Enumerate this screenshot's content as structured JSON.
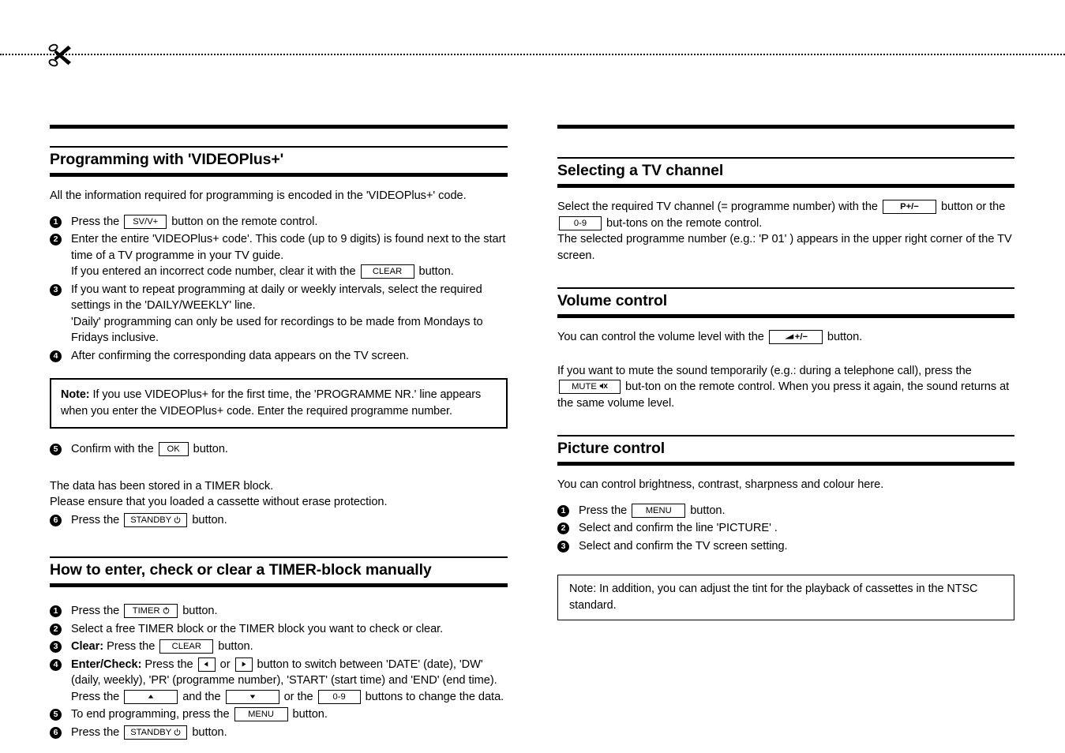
{
  "page": {
    "cut_line_icon": "scissors-icon"
  },
  "left_column": {
    "section1": {
      "title": "Programming with 'VIDEOPlus+'",
      "intro": "All the information required for programming is encoded in the 'VIDEOPlus+' code.",
      "steps": [
        {
          "num": "1",
          "lines": [
            {
              "parts": [
                {
                  "t": "text",
                  "v": "Press the "
                },
                {
                  "t": "key",
                  "v": "SV/V+"
                },
                {
                  "t": "text",
                  "v": " button on the remote control."
                }
              ]
            }
          ]
        },
        {
          "num": "2",
          "lines": [
            {
              "parts": [
                {
                  "t": "text",
                  "v": "Enter the entire 'VIDEOPlus+ code'. This code (up to 9 digits) is found next to the start time of a TV programme in your TV guide."
                }
              ]
            },
            {
              "parts": [
                {
                  "t": "text",
                  "v": "If you entered an incorrect code number, clear it with the "
                },
                {
                  "t": "key",
                  "v": "CLEAR"
                },
                {
                  "t": "text",
                  "v": " button."
                }
              ]
            }
          ]
        },
        {
          "num": "3",
          "lines": [
            {
              "parts": [
                {
                  "t": "text",
                  "v": "If you want to repeat programming at daily or weekly intervals, select the required settings in the 'DAILY/WEEKLY' line."
                }
              ]
            },
            {
              "parts": [
                {
                  "t": "text",
                  "v": "'Daily' programming can only be used for recordings to be made from Mondays to Fridays inclusive."
                }
              ]
            }
          ]
        },
        {
          "num": "4",
          "lines": [
            {
              "parts": [
                {
                  "t": "text",
                  "v": "After confirming the corresponding data appears on the TV screen."
                }
              ]
            }
          ]
        }
      ],
      "note": {
        "label": "Note:",
        "text": " If you use VIDEOPlus+ for the first time, the 'PROGRAMME NR.' line appears when you enter the VIDEOPlus+ code. Enter the required programme number."
      },
      "step5": {
        "num": "5",
        "parts": [
          {
            "t": "text",
            "v": "Confirm with the "
          },
          {
            "t": "key",
            "v": "OK"
          },
          {
            "t": "text",
            "v": " button."
          }
        ]
      },
      "closing": [
        "The data has been stored in a TIMER block.",
        "Please ensure that you loaded a cassette without erase protection."
      ],
      "step6": {
        "num": "6",
        "parts": [
          {
            "t": "text",
            "v": "Press the "
          },
          {
            "t": "key",
            "v": "STANDBY",
            "icon": "power-icon"
          },
          {
            "t": "text",
            "v": " button."
          }
        ]
      }
    },
    "section2": {
      "title": "How to enter, check or clear a TIMER-block manually",
      "steps": [
        {
          "num": "1",
          "parts": [
            {
              "t": "text",
              "v": "Press the "
            },
            {
              "t": "key",
              "v": "TIMER",
              "icon": "timer-icon"
            },
            {
              "t": "text",
              "v": " button."
            }
          ]
        },
        {
          "num": "2",
          "parts": [
            {
              "t": "text",
              "v": "Select a free TIMER block or the TIMER block you want to check or clear."
            }
          ]
        },
        {
          "num": "3",
          "parts": [
            {
              "t": "bold",
              "v": "Clear:"
            },
            {
              "t": "text",
              "v": " Press the "
            },
            {
              "t": "key",
              "v": "CLEAR"
            },
            {
              "t": "text",
              "v": " button."
            }
          ]
        },
        {
          "num": "4",
          "parts": [
            {
              "t": "bold",
              "v": "Enter/Check:"
            },
            {
              "t": "text",
              "v": " Press the "
            },
            {
              "t": "key_icon",
              "v": "left-triangle-icon"
            },
            {
              "t": "text",
              "v": " or "
            },
            {
              "t": "key_icon",
              "v": "right-triangle-icon"
            },
            {
              "t": "text",
              "v": " button to switch between 'DATE' (date), 'DW' (daily, weekly), 'PR' (programme number), 'START' (start time) and 'END' (end time)."
            }
          ],
          "line2": [
            {
              "t": "text",
              "v": "Press the "
            },
            {
              "t": "key_icon",
              "v": "up-triangle-icon"
            },
            {
              "t": "text",
              "v": " and the "
            },
            {
              "t": "key_icon",
              "v": "down-triangle-icon"
            },
            {
              "t": "text",
              "v": " or the "
            },
            {
              "t": "key",
              "v": "0-9"
            },
            {
              "t": "text",
              "v": " buttons to change the data."
            }
          ]
        },
        {
          "num": "5",
          "parts": [
            {
              "t": "text",
              "v": "To end programming, press the "
            },
            {
              "t": "key",
              "v": "MENU"
            },
            {
              "t": "text",
              "v": " button."
            }
          ]
        },
        {
          "num": "6",
          "parts": [
            {
              "t": "text",
              "v": "Press the "
            },
            {
              "t": "key",
              "v": "STANDBY",
              "icon": "power-icon"
            },
            {
              "t": "text",
              "v": " button."
            }
          ]
        }
      ]
    }
  },
  "right_column": {
    "section1": {
      "title": "Selecting a TV channel",
      "body_line1_a": "Select the required TV channel (= programme number) with the ",
      "key_p": "P",
      "key_plusminus": "+/−",
      "body_line1_b": " button or the ",
      "key_09": "0-9",
      "body_line1_c": " but-tons on the remote control.",
      "body_line2": "The selected programme number (e.g.: 'P 01' ) appears in the upper right corner of the TV screen."
    },
    "section2": {
      "title": "Volume control",
      "body_line1_a": "You can control the volume level with the ",
      "volume_key_label": "+/−",
      "volume_key_icon": "speaker-wedge-icon",
      "body_line1_b": " button.",
      "body_line2_a": "If you want to mute the sound temporarily (e.g.: during a telephone call), press the ",
      "mute_key_label": "MUTE",
      "mute_key_icon": "mute-speaker-icon",
      "body_line2_b": " but-ton on the remote control. When you press it again, the sound returns at the same volume level."
    },
    "section3": {
      "title": "Picture control",
      "intro": "You can control brightness, contrast, sharpness and colour here.",
      "steps": [
        {
          "num": "1",
          "parts": [
            {
              "t": "text",
              "v": "Press the "
            },
            {
              "t": "key",
              "v": "MENU"
            },
            {
              "t": "text",
              "v": " button."
            }
          ]
        },
        {
          "num": "2",
          "parts": [
            {
              "t": "text",
              "v": "Select and confirm the line 'PICTURE' ."
            }
          ]
        },
        {
          "num": "3",
          "parts": [
            {
              "t": "text",
              "v": "Select and confirm the TV screen setting."
            }
          ]
        }
      ],
      "note": "Note: In addition, you can adjust the tint for the playback of cassettes in the NTSC standard."
    }
  }
}
